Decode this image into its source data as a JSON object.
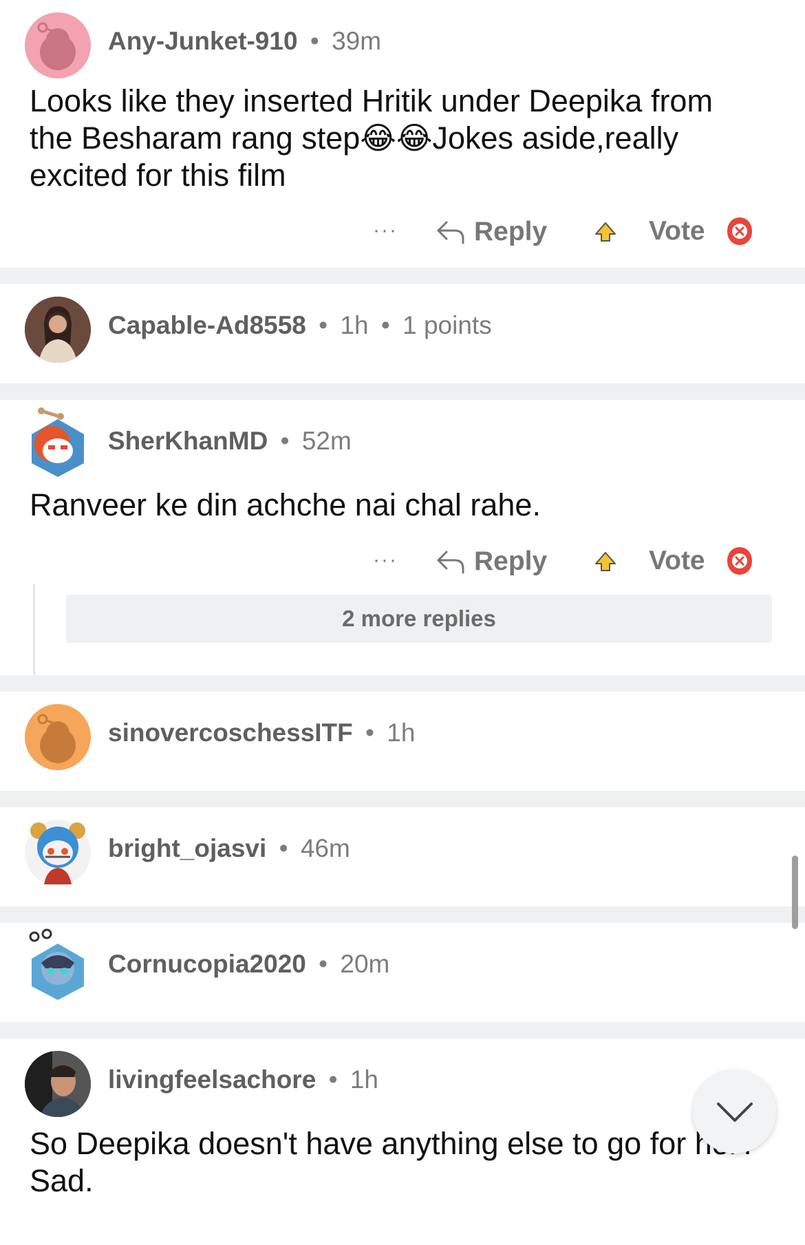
{
  "comments": [
    {
      "username": "Any-Junket-910",
      "time": "39m",
      "text": "Looks like they inserted Hritik under Deepika from the Besharam rang step😂😂Jokes aside,really excited for this film",
      "more_icon": "···",
      "reply_label": "Reply",
      "vote_label": "Vote"
    },
    {
      "username": "Capable-Ad8558",
      "time": "1h",
      "points": "1 points"
    },
    {
      "username": "SherKhanMD",
      "time": "52m",
      "text": "Ranveer ke din achche nai chal rahe.",
      "more_icon": "···",
      "reply_label": "Reply",
      "vote_label": "Vote",
      "more_replies": "2 more replies"
    },
    {
      "username": "sinovercoschessITF",
      "time": "1h"
    },
    {
      "username": "bright_ojasvi",
      "time": "46m"
    },
    {
      "username": "Cornucopia2020",
      "time": "20m"
    },
    {
      "username": "livingfeelsachore",
      "time": "1h",
      "text": "So Deepika doesn't have anything else to go for her? Sad."
    }
  ],
  "separator": "•",
  "colors": {
    "separator_bg": "#eef0f2",
    "meta_text": "#7c7c7c",
    "avatar_pink": "#f2a2b0",
    "avatar_orange": "#f5a65b",
    "downvote_red": "#e8453c",
    "upvote_yellow": "#f4c430"
  },
  "icons": {
    "reply": "reply-arrow-icon",
    "upvote": "upvote-icon",
    "downvote": "downvote-icon",
    "scroll_down": "chevron-down-icon"
  }
}
